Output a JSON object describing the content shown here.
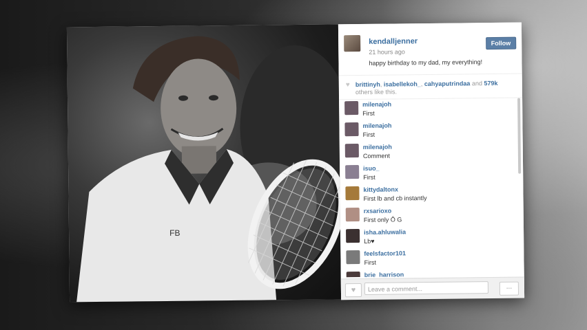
{
  "post": {
    "username": "kendalljenner",
    "time": "21 hours ago",
    "caption": "happy birthday to my dad, my everything!",
    "follow_label": "Follow"
  },
  "likes": {
    "user1": "brittinyh",
    "user2": "isabellekoh_",
    "user3": "cahyaputrindaa",
    "and_text": " and ",
    "count": "579k",
    "suffix": " others like this."
  },
  "comments": [
    {
      "user": "milenajoh",
      "text": "First",
      "avatar_color": "#6b5a66"
    },
    {
      "user": "milenajoh",
      "text": "First",
      "avatar_color": "#6b5a66"
    },
    {
      "user": "milenajoh",
      "text": "Comment",
      "avatar_color": "#6b5a66"
    },
    {
      "user": "isuo_",
      "text": "First",
      "avatar_color": "#8a7f92"
    },
    {
      "user": "kittydaltonx",
      "text": "First lb and cb instantly",
      "avatar_color": "#a57a3a"
    },
    {
      "user": "rxsarioxo",
      "text": "First only Ô G",
      "avatar_color": "#b08f84"
    },
    {
      "user": "isha.ahluwalia",
      "text": "Lb♥",
      "avatar_color": "#3b3030"
    },
    {
      "user": "feelsfactor101",
      "text": "First",
      "avatar_color": "#7a7a7a"
    },
    {
      "user": "brie_harrison",
      "text": "",
      "avatar_color": "#4a3a3a"
    }
  ],
  "footer": {
    "comment_placeholder": "Leave a comment...",
    "more_label": "..."
  },
  "colors": {
    "link_blue": "#3c6fa0",
    "follow_bg": "#5b7fa6"
  }
}
